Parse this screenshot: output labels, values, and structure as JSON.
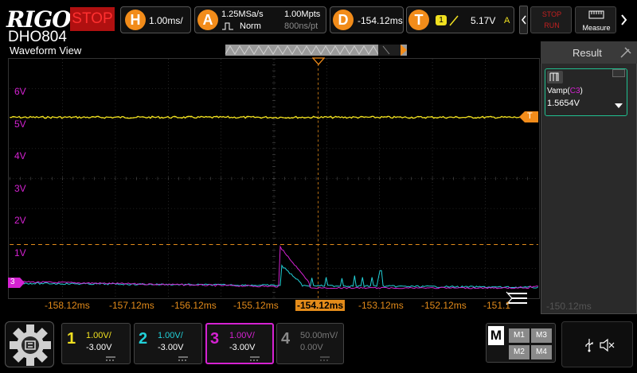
{
  "brand": {
    "logo": "RIGOL",
    "model": "DHO804",
    "run_state": "STOP"
  },
  "colors": {
    "ch1": "#f0e020",
    "ch2": "#22d0d8",
    "ch3": "#d522d2",
    "ch4": "#6a6a6a",
    "accent": "#f28c1a",
    "stop": "#b01010"
  },
  "horizontal": {
    "badge": "H",
    "timebase": "1.00ms/"
  },
  "acquire": {
    "badge": "A",
    "sample_rate": "1.25MSa/s",
    "memory": "1.00Mpts",
    "mode": "Norm",
    "interval": "800ns/pt"
  },
  "delay": {
    "badge": "D",
    "value": "-154.12ms"
  },
  "trigger": {
    "badge": "T",
    "source": "1",
    "slope": "rising",
    "level": "5.17V",
    "mode": "A"
  },
  "toolbar": {
    "stop_label": "STOP",
    "run_label": "RUN",
    "measure_label": "Measure"
  },
  "waveform": {
    "title": "Waveform View",
    "y_ticks": [
      "6V",
      "5V",
      "4V",
      "3V",
      "2V",
      "1V"
    ],
    "x_ticks": [
      "-158.12ms",
      "-157.12ms",
      "-156.12ms",
      "-155.12ms",
      "-154.12ms",
      "-153.12ms",
      "-152.12ms",
      "-151.1"
    ],
    "ch3_marker": "3",
    "trigger_marker": "T"
  },
  "result_panel": {
    "title": "Result",
    "measurement_name": "Vamp(",
    "measurement_channel": "C3",
    "measurement_close": ")",
    "measurement_value": "1.5654V",
    "faded_tick": "-150.12ms"
  },
  "channels": [
    {
      "num": "1",
      "scale": "1.00V/",
      "offset": "-3.00V",
      "color": "#f0e020"
    },
    {
      "num": "2",
      "scale": "1.00V/",
      "offset": "-3.00V",
      "color": "#22d0d8"
    },
    {
      "num": "3",
      "scale": "1.00V/",
      "offset": "-3.00V",
      "color": "#d522d2"
    },
    {
      "num": "4",
      "scale": "50.00mV/",
      "offset": "0.00V",
      "color": "#6a6a6a"
    }
  ],
  "math": {
    "badge": "M",
    "items": [
      "M1",
      "M3",
      "M2",
      "M4"
    ]
  }
}
